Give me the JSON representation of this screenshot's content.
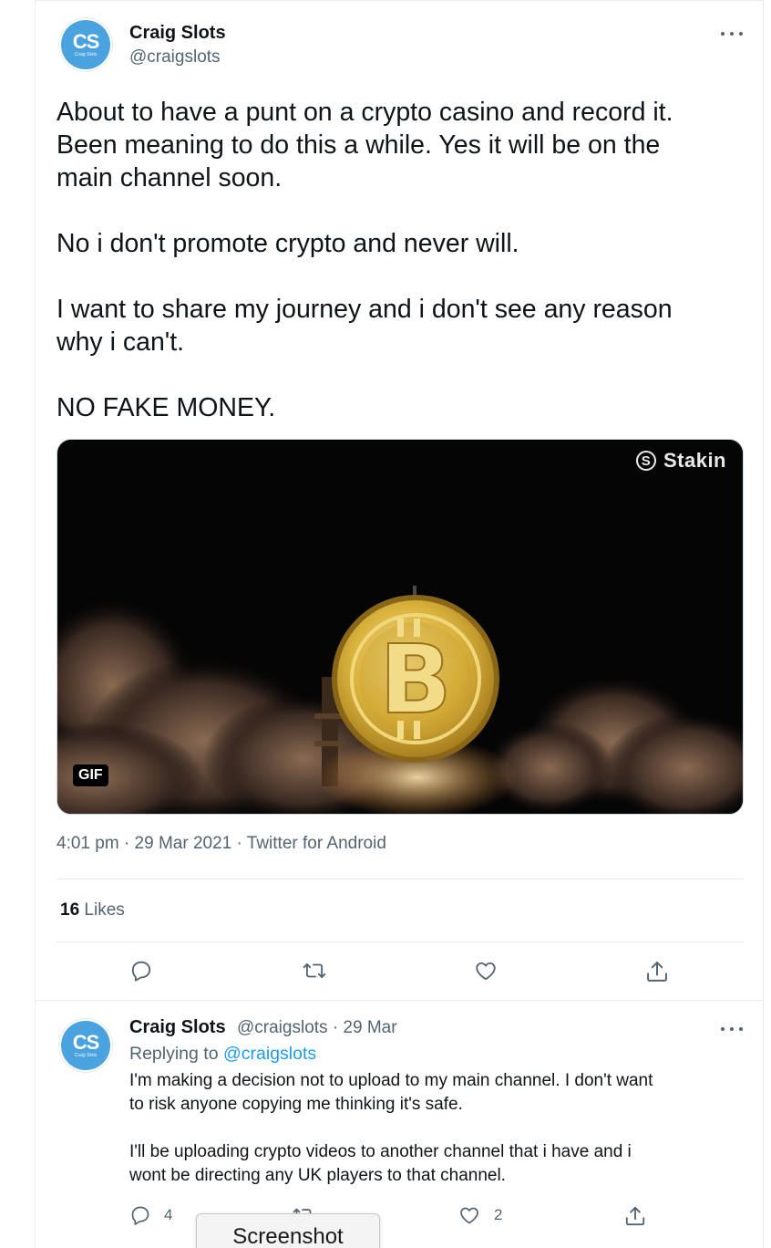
{
  "tweet": {
    "author_name": "Craig Slots",
    "author_handle": "@craigslots",
    "avatar": {
      "monogram": "CS",
      "subtitle": "Craig Slots",
      "color": "#4aa3df"
    },
    "paragraphs": [
      "About to have a punt on a crypto casino and record it.\nBeen meaning to do this a while. Yes it will be on the\nmain channel soon.",
      "No i don't promote crypto and never will.",
      "I want to share my journey and i don't see any reason\nwhy i can't.",
      "NO FAKE MONEY."
    ],
    "media": {
      "watermark": "Stakin",
      "watermark_icon": "stakin-logo-icon",
      "badge": "GIF"
    },
    "timestamp": "4:01 pm · 29 Mar 2021 · Twitter for Android",
    "likes_count": "16",
    "likes_label": "Likes"
  },
  "reply": {
    "author_name": "Craig Slots",
    "author_handle": "@craigslots",
    "date": "· 29 Mar",
    "replying_prefix": "Replying to",
    "replying_to": "@craigslots",
    "paragraphs": [
      "I'm making a decision not to upload to my main channel. I don't want\nto risk anyone copying me thinking it's safe.",
      "I'll be uploading crypto videos to another channel that i have and i\nwont be directing any UK players to that channel."
    ],
    "reply_count": "4",
    "like_count": "2"
  },
  "tooltip": {
    "label": "Screenshot"
  },
  "icons": [
    "reply-icon",
    "retweet-icon",
    "like-icon",
    "share-icon",
    "more-icon",
    "bitcoin-icon"
  ],
  "colors": {
    "link": "#1d9bf0",
    "secondary_text": "#536471",
    "bitcoin_gold": "#d9b23c"
  }
}
